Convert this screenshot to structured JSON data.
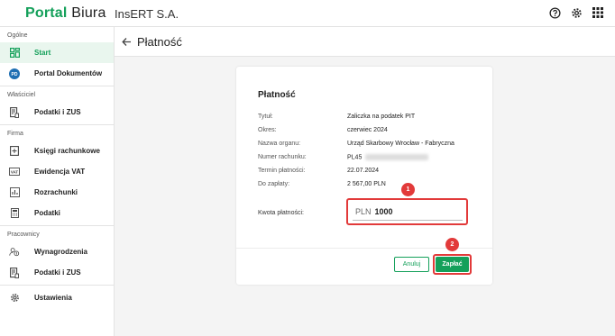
{
  "app": {
    "logo_part1": "Portal",
    "logo_part2": "Biura",
    "company": "InsERT S.A."
  },
  "top_icons": [
    "help-icon",
    "gear-icon",
    "apps-grid-icon"
  ],
  "sidebar": {
    "sections": [
      {
        "label": "Ogólne",
        "items": [
          {
            "label": "Start",
            "icon": "dashboard-icon",
            "active": true
          },
          {
            "label": "Portal Dokumentów",
            "icon": "pd-badge-icon",
            "active": false
          }
        ]
      },
      {
        "label": "Właściciel",
        "items": [
          {
            "label": "Podatki i ZUS",
            "icon": "tax-document-icon",
            "active": false
          }
        ]
      },
      {
        "label": "Firma",
        "items": [
          {
            "label": "Księgi rachunkowe",
            "icon": "ledger-icon",
            "active": false
          },
          {
            "label": "Ewidencja VAT",
            "icon": "vat-icon",
            "active": false
          },
          {
            "label": "Rozrachunki",
            "icon": "chart-icon",
            "active": false
          },
          {
            "label": "Podatki",
            "icon": "calculator-icon",
            "active": false
          }
        ]
      },
      {
        "label": "Pracownicy",
        "items": [
          {
            "label": "Wynagrodzenia",
            "icon": "payroll-icon",
            "active": false
          },
          {
            "label": "Podatki i ZUS",
            "icon": "tax-document-icon",
            "active": false
          }
        ]
      }
    ],
    "settings": {
      "label": "Ustawienia",
      "icon": "gear-icon"
    }
  },
  "header": {
    "title": "Płatność"
  },
  "card": {
    "title": "Płatność",
    "fields": [
      {
        "label": "Tytuł:",
        "value": "Zaliczka na podatek PIT"
      },
      {
        "label": "Okres:",
        "value": "czerwiec 2024"
      },
      {
        "label": "Nazwa organu:",
        "value": "Urząd Skarbowy Wrocław - Fabryczna"
      },
      {
        "label": "Numer rachunku:",
        "value": "PL45"
      },
      {
        "label": "Termin płatności:",
        "value": "22.07.2024"
      },
      {
        "label": "Do zapłaty:",
        "value": "2 567,00 PLN"
      }
    ],
    "amount": {
      "label": "Kwota płatności:",
      "currency": "PLN",
      "value": "1000"
    },
    "cancel_label": "Anuluj",
    "pay_label": "Zapłać",
    "badges": [
      "1",
      "2"
    ]
  },
  "colors": {
    "brand": "#14a05a",
    "highlight": "#e23a3a"
  }
}
